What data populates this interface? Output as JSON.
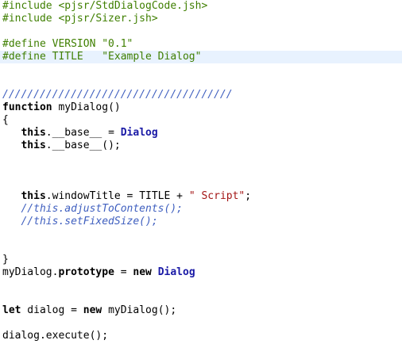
{
  "editor": {
    "highlight_color": "#e8f2fe",
    "lines": [
      [
        {
          "t": "#include <pjsr/StdDialogCode.jsh>",
          "c": "preproc"
        }
      ],
      [
        {
          "t": "#include <pjsr/Sizer.jsh>",
          "c": "preproc"
        }
      ],
      [],
      [
        {
          "t": "#define VERSION \"0.1\"",
          "c": "preproc"
        }
      ],
      [
        {
          "t": "#define TITLE   \"Example Dialog\"",
          "c": "preproc"
        }
      ],
      [],
      [],
      [
        {
          "t": "/////////////////////////////////////",
          "c": "comment"
        }
      ],
      [
        {
          "t": "function",
          "c": "kw"
        },
        {
          "t": " myDialog()",
          "c": "plain"
        }
      ],
      [
        {
          "t": "{",
          "c": "plain"
        }
      ],
      [
        {
          "t": "   ",
          "c": "plain"
        },
        {
          "t": "this",
          "c": "kw"
        },
        {
          "t": ".__base__ = ",
          "c": "plain"
        },
        {
          "t": "Dialog",
          "c": "cls"
        }
      ],
      [
        {
          "t": "   ",
          "c": "plain"
        },
        {
          "t": "this",
          "c": "kw"
        },
        {
          "t": ".__base__();",
          "c": "plain"
        }
      ],
      [],
      [],
      [],
      [
        {
          "t": "   ",
          "c": "plain"
        },
        {
          "t": "this",
          "c": "kw"
        },
        {
          "t": ".windowTitle = TITLE + ",
          "c": "plain"
        },
        {
          "t": "\" Script\"",
          "c": "str red"
        },
        {
          "t": ";",
          "c": "plain"
        }
      ],
      [
        {
          "t": "   //this.adjustToContents();",
          "c": "comment"
        }
      ],
      [
        {
          "t": "   //this.setFixedSize();",
          "c": "comment"
        }
      ],
      [],
      [],
      [
        {
          "t": "}",
          "c": "plain"
        }
      ],
      [
        {
          "t": "myDialog.",
          "c": "plain"
        },
        {
          "t": "prototype",
          "c": "kw"
        },
        {
          "t": " = ",
          "c": "plain"
        },
        {
          "t": "new",
          "c": "kw"
        },
        {
          "t": " ",
          "c": "plain"
        },
        {
          "t": "Dialog",
          "c": "cls"
        }
      ],
      [],
      [],
      [
        {
          "t": "let",
          "c": "kw"
        },
        {
          "t": " dialog = ",
          "c": "plain"
        },
        {
          "t": "new",
          "c": "kw"
        },
        {
          "t": " myDialog();",
          "c": "plain"
        }
      ],
      [],
      [
        {
          "t": "dialog.execute();",
          "c": "plain"
        }
      ]
    ],
    "highlight_line_index": 4
  }
}
